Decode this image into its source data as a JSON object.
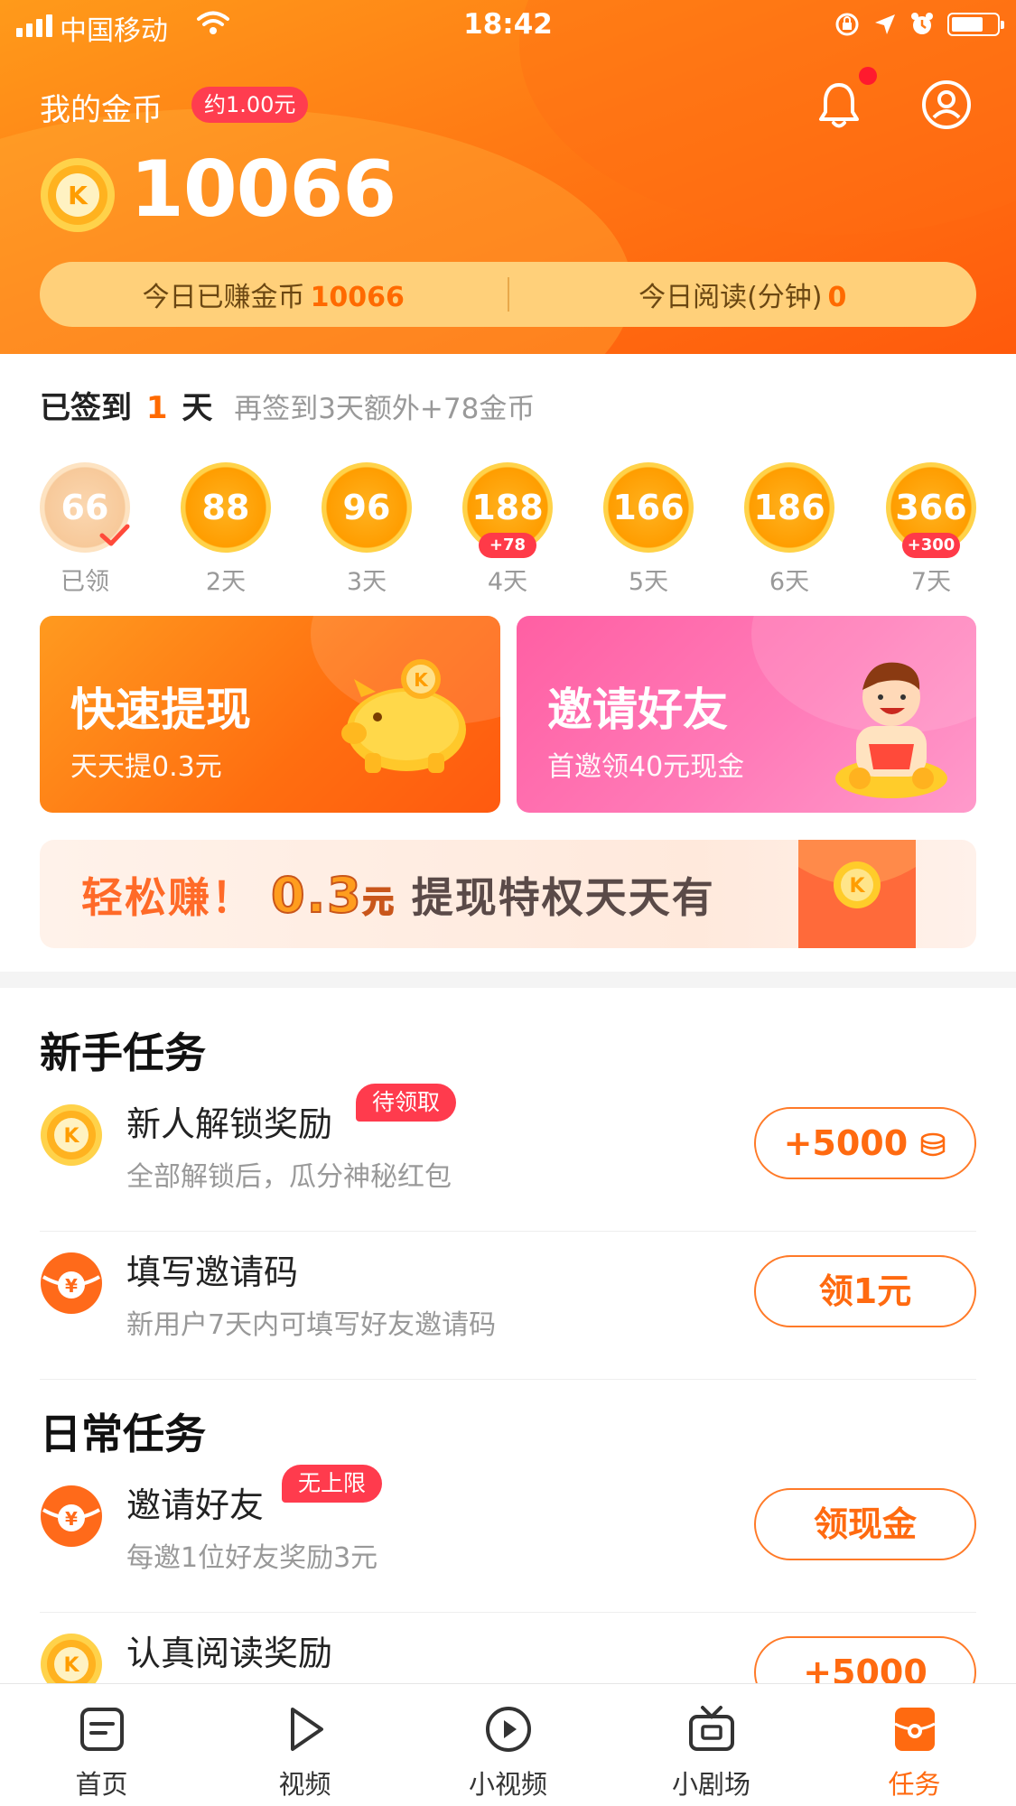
{
  "status": {
    "carrier": "中国移动",
    "time": "18:42"
  },
  "header": {
    "title": "我的金币",
    "approx": "约1.00元",
    "balance": "10066",
    "today_earned_label": "今日已赚金币",
    "today_earned_value": "10066",
    "today_read_label": "今日阅读(分钟)",
    "today_read_value": "0"
  },
  "checkin": {
    "prefix": "已签到",
    "days": "1",
    "suffix": "天",
    "extra": "再签到3天额外+78金币",
    "items": [
      {
        "value": "66",
        "label": "已领",
        "claimed": true
      },
      {
        "value": "88",
        "label": "2天"
      },
      {
        "value": "96",
        "label": "3天"
      },
      {
        "value": "188",
        "label": "4天",
        "bonus": "+78"
      },
      {
        "value": "166",
        "label": "5天"
      },
      {
        "value": "186",
        "label": "6天"
      },
      {
        "value": "366",
        "label": "7天",
        "bonus": "+300"
      }
    ]
  },
  "promo": {
    "withdraw_title": "快速提现",
    "withdraw_sub": "天天提0.3元",
    "invite_title": "邀请好友",
    "invite_sub": "首邀领40元现金"
  },
  "banner": {
    "lead": "轻松赚！",
    "amount": "0.3",
    "unit": "元",
    "rest": "提现特权天天有"
  },
  "newbie": {
    "title": "新手任务",
    "tasks": [
      {
        "name": "新人解锁奖励",
        "tag": "待领取",
        "desc": "全部解锁后，瓜分神秘红包",
        "button": "+5000"
      },
      {
        "name": "填写邀请码",
        "desc": "新用户7天内可填写好友邀请码",
        "button": "领1元"
      }
    ]
  },
  "daily": {
    "title": "日常任务",
    "tasks": [
      {
        "name": "邀请好友",
        "tag": "无上限",
        "desc": "每邀1位好友奖励3元",
        "button": "领现金"
      },
      {
        "name": "认真阅读奖励",
        "button": "+5000"
      }
    ]
  },
  "tabs": [
    {
      "label": "首页",
      "icon": "home-icon"
    },
    {
      "label": "视频",
      "icon": "play-icon"
    },
    {
      "label": "小视频",
      "icon": "circle-play-icon"
    },
    {
      "label": "小剧场",
      "icon": "tv-icon"
    },
    {
      "label": "任务",
      "icon": "task-icon",
      "active": true
    }
  ],
  "colors": {
    "accent": "#ff6a10",
    "tag": "#ff3b4d",
    "header_start": "#ff9a1a",
    "header_end": "#ff5a0c"
  }
}
